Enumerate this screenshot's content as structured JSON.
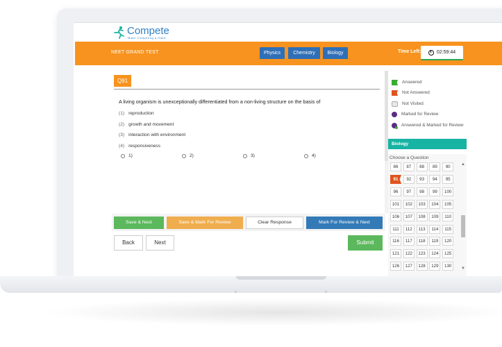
{
  "logo": {
    "name": "Compete",
    "tagline": "Make Competing a Habit"
  },
  "topbar": {
    "test_name": "NEET GRAND TEST",
    "subjects": [
      "Physics",
      "Chemistry",
      "Biology"
    ],
    "time_left_label": "Time Left:",
    "time_left_value": "02:59:44"
  },
  "question": {
    "badge": "Q91",
    "text": "A living organism is unexceptionally differentiated from a non-living structure on the basis of",
    "options": [
      {
        "num": "(1)",
        "text": "reproduction"
      },
      {
        "num": "(2)",
        "text": "growth and movement"
      },
      {
        "num": "(3)",
        "text": "interaction with environment"
      },
      {
        "num": "(4)",
        "text": "responsiveness"
      }
    ],
    "answer_choices": [
      "1)",
      "2)",
      "3)",
      "4)"
    ]
  },
  "actions": {
    "save_next": "Save & Next",
    "save_mark_review": "Save & Mark For Review",
    "clear_response": "Clear Response",
    "mark_review_next": "Mark For Review & Next",
    "back": "Back",
    "next": "Next",
    "submit": "Submit"
  },
  "legend": [
    {
      "label": "Answered",
      "icon": "answered-flag-icon"
    },
    {
      "label": "Not Answered",
      "icon": "not-answered-flag-icon"
    },
    {
      "label": "Not Visited",
      "icon": "not-visited-box-icon"
    },
    {
      "label": "Marked for Review",
      "icon": "marked-review-circle-icon"
    },
    {
      "label": "Answered & Marked for Review",
      "icon": "answered-marked-circle-icon"
    }
  ],
  "palette": {
    "section": "Biology",
    "choose_label": "Choose a Question",
    "current": "91",
    "numbers": [
      "86",
      "87",
      "88",
      "89",
      "90",
      "91",
      "92",
      "93",
      "94",
      "95",
      "96",
      "97",
      "98",
      "99",
      "100",
      "101",
      "102",
      "103",
      "104",
      "105",
      "106",
      "107",
      "108",
      "109",
      "110",
      "111",
      "112",
      "113",
      "114",
      "115",
      "116",
      "117",
      "118",
      "119",
      "120",
      "121",
      "122",
      "123",
      "124",
      "125",
      "126",
      "127",
      "128",
      "129",
      "130"
    ]
  },
  "colors": {
    "topbar": "#f7931e",
    "subject_button": "#2f6fb7",
    "save_next": "#5cb85c",
    "save_mark": "#f0ad4e",
    "mark_next": "#337ab7",
    "section_bar": "#17b3a3",
    "not_answered": "#e0541f"
  }
}
